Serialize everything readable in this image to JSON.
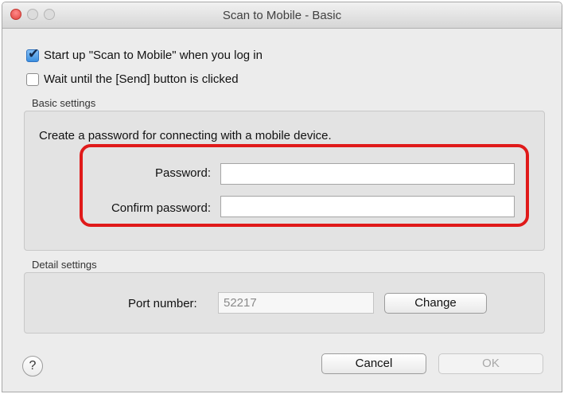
{
  "window": {
    "title": "Scan to Mobile - Basic"
  },
  "options": {
    "startup": {
      "label": "Start up \"Scan to Mobile\" when you log in",
      "checked": true
    },
    "wait_send": {
      "label": "Wait until the [Send] button is clicked",
      "checked": false
    }
  },
  "basic_settings": {
    "legend": "Basic settings",
    "description": "Create a password for connecting with a mobile device.",
    "password_label": "Password:",
    "password_value": "",
    "confirm_label": "Confirm password:",
    "confirm_value": ""
  },
  "detail_settings": {
    "legend": "Detail settings",
    "port_label": "Port number:",
    "port_value": "52217",
    "change_label": "Change"
  },
  "footer": {
    "help_glyph": "?",
    "cancel_label": "Cancel",
    "ok_label": "OK"
  },
  "colors": {
    "highlight": "#e01a1a",
    "checkbox_accent": "#3b8fe0"
  }
}
